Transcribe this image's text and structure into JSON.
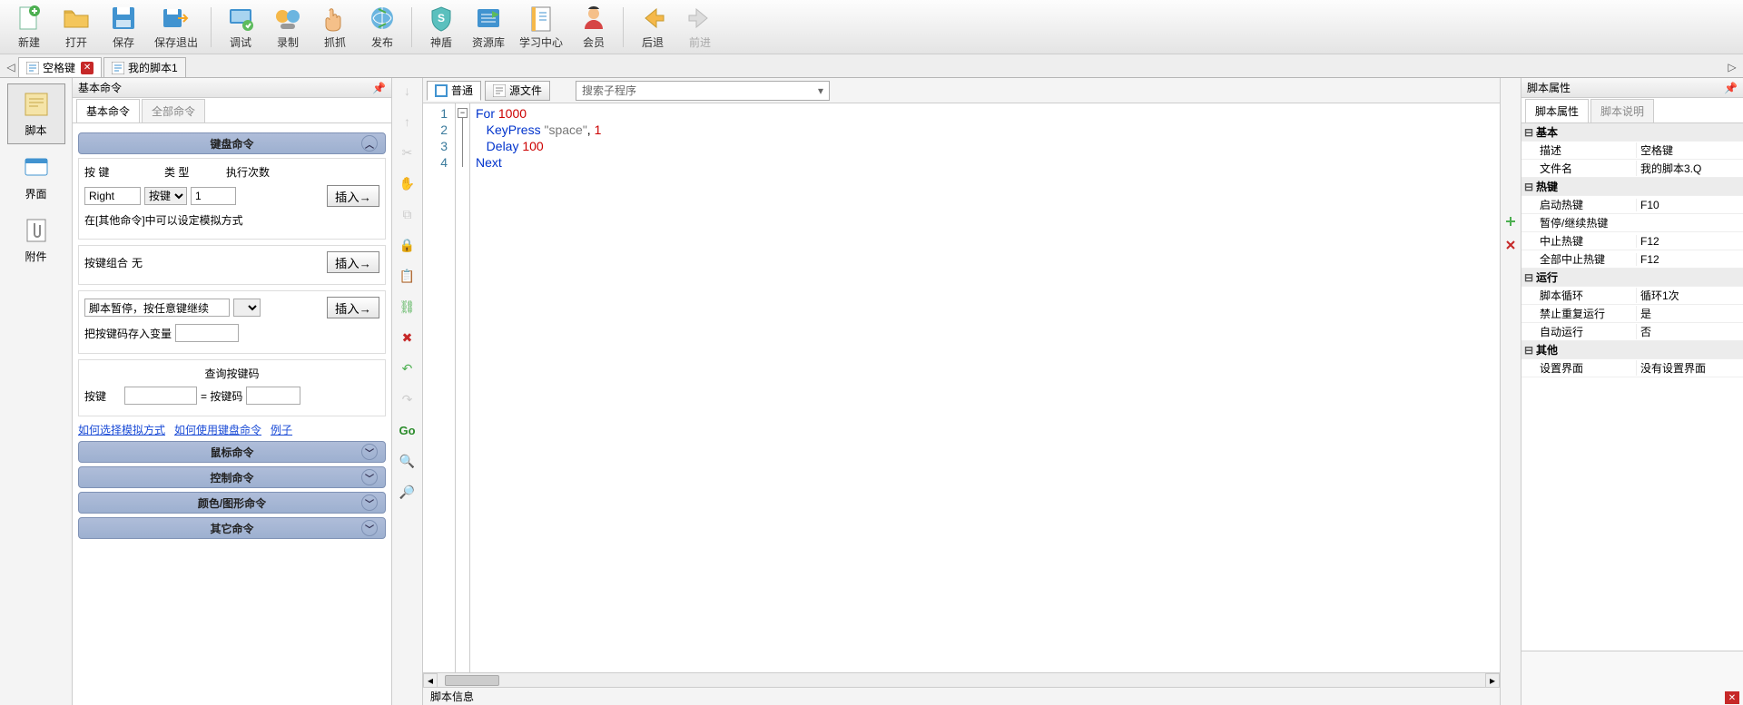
{
  "toolbar": {
    "new": "新建",
    "open": "打开",
    "save": "保存",
    "save_exit": "保存退出",
    "debug": "调试",
    "record": "录制",
    "grab": "抓抓",
    "publish": "发布",
    "shield": "神盾",
    "repo": "资源库",
    "learn": "学习中心",
    "member": "会员",
    "back": "后退",
    "forward": "前进"
  },
  "tabs": {
    "active": "空格键",
    "second": "我的脚本1"
  },
  "left_rail": {
    "script": "脚本",
    "ui": "界面",
    "attach": "附件"
  },
  "cmd_panel": {
    "title": "基本命令",
    "tab_basic": "基本命令",
    "tab_all": "全部命令",
    "keyboard_header": "键盘命令",
    "lbl_key": "按 键",
    "lbl_type": "类 型",
    "lbl_times": "执行次数",
    "key_value": "Right",
    "type_value": "按键",
    "times_value": "1",
    "insert": "插入→",
    "note1": "在[其他命令]中可以设定模拟方式",
    "combo_lbl": "按键组合",
    "combo_val": "无",
    "pause_text": "脚本暂停，按任意键继续",
    "save_keycode": "把按键码存入变量",
    "query_header": "查询按键码",
    "lbl_key2": "按键",
    "lbl_eq": "= 按键码",
    "link1": "如何选择模拟方式",
    "link2": "如何使用键盘命令",
    "link3": "例子",
    "mouse_header": "鼠标命令",
    "control_header": "控制命令",
    "color_header": "颜色/图形命令",
    "other_header": "其它命令"
  },
  "editor": {
    "view_normal": "普通",
    "view_source": "源文件",
    "search_placeholder": "搜索子程序",
    "script_info": "脚本信息",
    "code": [
      {
        "n": "1",
        "parts": [
          {
            "t": "For ",
            "c": "kw"
          },
          {
            "t": "1000",
            "c": "num"
          }
        ]
      },
      {
        "n": "2",
        "parts": [
          {
            "t": "   ",
            "c": ""
          },
          {
            "t": "KeyPress ",
            "c": "kw"
          },
          {
            "t": "\"space\"",
            "c": "str"
          },
          {
            "t": ", ",
            "c": ""
          },
          {
            "t": "1",
            "c": "num"
          }
        ]
      },
      {
        "n": "3",
        "parts": [
          {
            "t": "   ",
            "c": ""
          },
          {
            "t": "Delay ",
            "c": "kw"
          },
          {
            "t": "100",
            "c": "num"
          }
        ]
      },
      {
        "n": "4",
        "parts": [
          {
            "t": "Next",
            "c": "kw"
          }
        ]
      }
    ]
  },
  "props": {
    "title": "脚本属性",
    "tab_props": "脚本属性",
    "tab_desc": "脚本说明",
    "cat_basic": "基本",
    "desc": "描述",
    "desc_v": "空格键",
    "fname": "文件名",
    "fname_v": "我的脚本3.Q",
    "cat_hotkey": "热键",
    "start": "启动热键",
    "start_v": "F10",
    "pause": "暂停/继续热键",
    "pause_v": "",
    "stop": "中止热键",
    "stop_v": "F12",
    "stopall": "全部中止热键",
    "stopall_v": "F12",
    "cat_run": "运行",
    "loop": "脚本循环",
    "loop_v": "循环1次",
    "norepeat": "禁止重复运行",
    "norepeat_v": "是",
    "autorun": "自动运行",
    "autorun_v": "否",
    "cat_other": "其他",
    "setui": "设置界面",
    "setui_v": "没有设置界面"
  }
}
